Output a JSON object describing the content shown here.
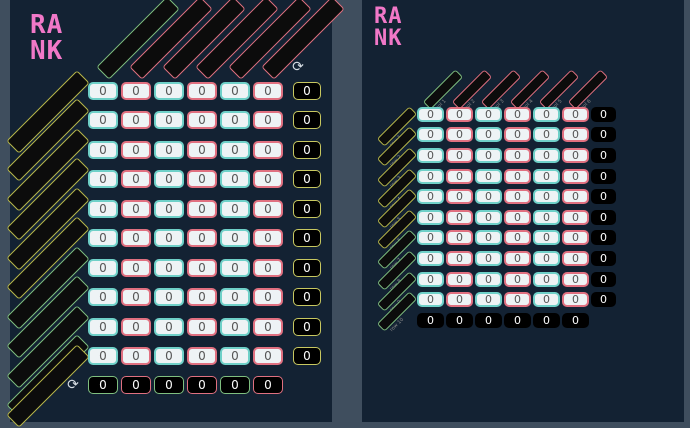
{
  "left": {
    "logo": {
      "line1": "RA",
      "line2": "NK"
    },
    "cell_value": "0",
    "refresh_icon": "refresh-icon"
  },
  "right": {
    "logo": {
      "line1": "RA",
      "line2": "NK"
    },
    "cell_value": "0",
    "column_labels": [
      "col 1",
      "col 2",
      "col 3",
      "col 4",
      "col 5",
      "col 6"
    ],
    "row_labels": [
      "row 1",
      "row 2",
      "row 3",
      "row 4",
      "row 5",
      "row 6",
      "row 7",
      "row 8",
      "row 9",
      "row 10"
    ]
  },
  "colors": {
    "background": "#3f4e5e",
    "panel": "#132233",
    "logo": "#f178c8",
    "teal_border": "#6fd0c8",
    "red_border": "#e07080",
    "yellow_border": "#c8c860",
    "green_border": "#7fbf7f"
  }
}
